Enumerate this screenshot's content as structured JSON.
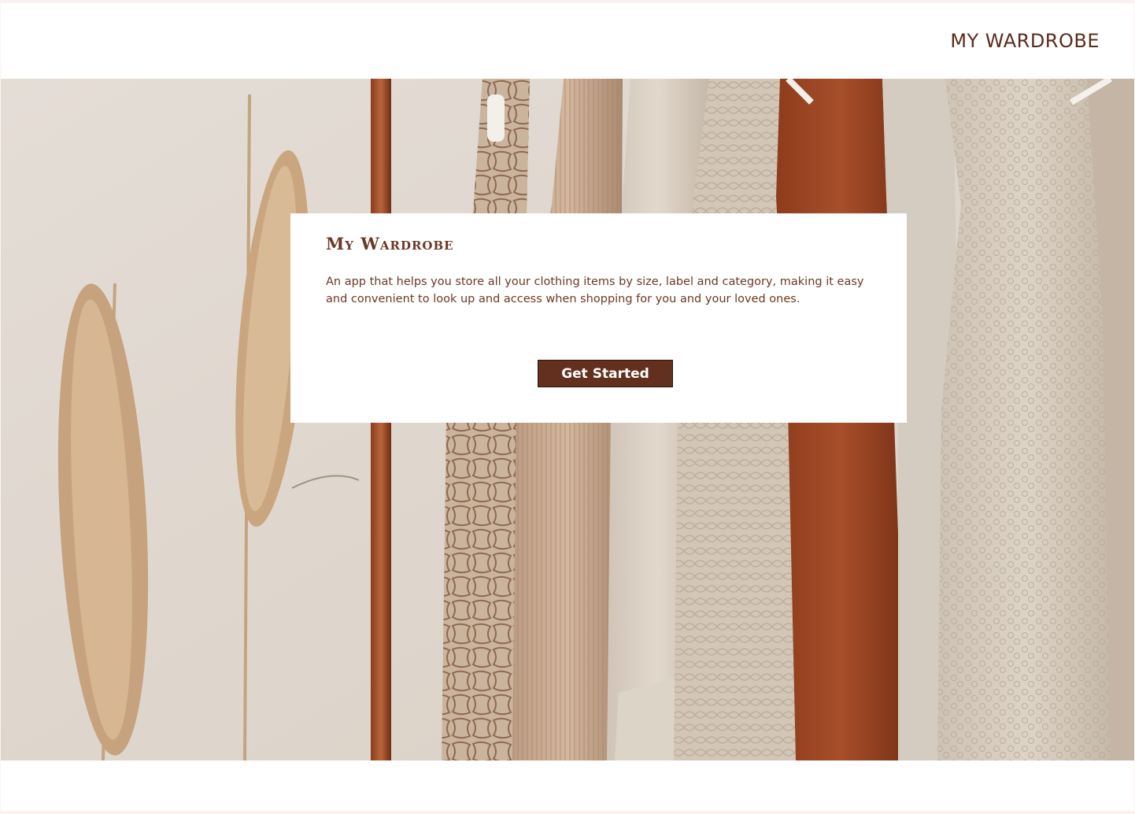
{
  "header": {
    "title": "MY WARDROBE"
  },
  "hero": {
    "image": "clothing-rack-with-pampas-grass-photo"
  },
  "card": {
    "title": "My Wardrobe",
    "description": "An app that helps you store all your clothing items by size, label and category, making it easy and convenient  to look up and access when shopping for you and your loved ones.",
    "cta_label": "Get Started"
  },
  "colors": {
    "brand_brown": "#63301f",
    "text_brown": "#6b3826",
    "page_background": "#fbf4f1"
  }
}
